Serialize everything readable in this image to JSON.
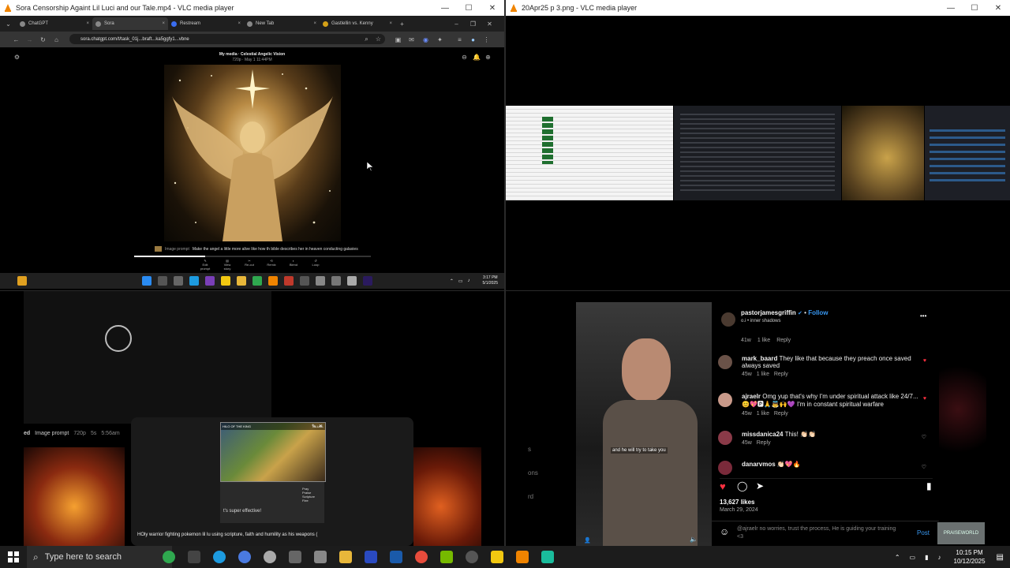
{
  "win_top_left": {
    "title": "Sora Censorship Againt Lil Luci and our Tale.mp4 - VLC media player",
    "controls": [
      "—",
      "☐",
      "✕"
    ],
    "tabs": [
      {
        "label": "ChatGPT",
        "close": "×"
      },
      {
        "label": "Sora",
        "close": "×"
      },
      {
        "label": "Restream",
        "close": "×"
      },
      {
        "label": "New Tab",
        "close": "×"
      },
      {
        "label": "Gastlellin vs. Kenny",
        "close": "×"
      }
    ],
    "new_tab": "+",
    "url": "sora.chatgpt.com/t/task_01j...braft...ka5ggfy1...vbne",
    "sora_title": "My media · Celestial Angelic Vision",
    "sora_subtitle": "720p · May 1 11:44PM",
    "prompt_label": "Image prompt",
    "prompt_text": "Make the angel a little more alive like how th bible describes her in heaven conducting galaxies",
    "sora_controls": [
      "Edit prompt",
      "View story",
      "Re-cut",
      "Remix",
      "Blend",
      "Loop"
    ],
    "taskbar_time": "3:17 PM",
    "taskbar_date": "5/1/2025"
  },
  "win_top_right": {
    "title": "20Apr25 p 3.png - VLC media player",
    "controls": [
      "—",
      "☐",
      "✕"
    ]
  },
  "win_bottom_left": {
    "prompt_tag": "ed",
    "prompt_label": "Image prompt",
    "prompt_res": "720p",
    "prompt_dur": "5s",
    "prompt_time": "5:56am",
    "card_header_left": "HILO OF THE KING",
    "card_header_right": "LILUCI-",
    "card_question": "t's super effective!",
    "card_menu": [
      "Pray",
      "Praise",
      "Scripture",
      "Flee"
    ],
    "caption": "HOly warrior fighting pokemon lil lu using scripture, faith and humility as his weapons ("
  },
  "win_bottom_right": {
    "left_fragments": [
      "s",
      "ons",
      "rd"
    ],
    "video_caption": "and he will try to take you",
    "username": "pastorjamesgriffin",
    "follow": "Follow",
    "audio": "o.i • inner shadows",
    "more": "•••",
    "first_meta": {
      "time": "41w",
      "likes": "1 like",
      "reply": "Reply"
    },
    "comments": [
      {
        "user": "mark_baard",
        "text": "They like that because they preach once saved always saved",
        "time": "45w",
        "likes": "1 like",
        "reply": "Reply",
        "liked": true
      },
      {
        "user": "ajraelr",
        "text": "Omg yup that's why I'm under spiritual attack like 24/7... 😊💖🅿🙏👼🙌💜 I'm in constant spiritual warfare",
        "time": "45w",
        "likes": "1 like",
        "reply": "Reply",
        "liked": true
      },
      {
        "user": "missdanica24",
        "text": "This! 👏🏻👏🏻",
        "time": "45w",
        "likes": "",
        "reply": "Reply",
        "liked": false
      },
      {
        "user": "danarvmos",
        "text": "👏🏻💖🔥",
        "time": "",
        "likes": "",
        "reply": "",
        "liked": false
      }
    ],
    "likes_count": "13,627 likes",
    "post_date": "March 29, 2024",
    "comment_input": "@ajraelr no worries, trust the process, He is guiding your training <3",
    "post_button": "Post",
    "watermark": "PRAISEWORLD"
  },
  "taskbar": {
    "search_placeholder": "Type here to search",
    "time": "10:15 PM",
    "date": "10/12/2025"
  }
}
